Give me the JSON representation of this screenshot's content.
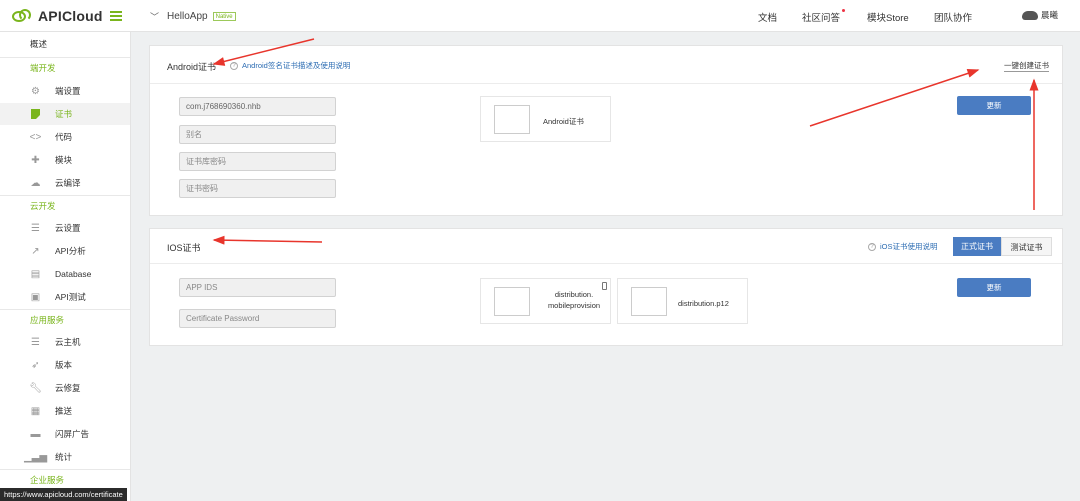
{
  "topbar": {
    "logo_text": "APICloud",
    "app_name": "HelloApp",
    "app_badge": "Native",
    "nav": [
      "文档",
      "社区问答",
      "模块Store",
      "团队协作"
    ],
    "user": "晨曦"
  },
  "sidebar": {
    "overview": "概述",
    "sections": {
      "dev": "端开发",
      "cloud": "云开发",
      "app_services": "应用服务",
      "enterprise": "企业服务"
    },
    "dev_items": [
      "端设置",
      "证书",
      "代码",
      "模块",
      "云编译"
    ],
    "cloud_items": [
      "云设置",
      "API分析",
      "Database",
      "API测试"
    ],
    "service_items": [
      "云主机",
      "版本",
      "云修复",
      "推送",
      "闪屏广告",
      "统计"
    ]
  },
  "android": {
    "title": "Android证书",
    "help": "Android签名证书描述及使用说明",
    "one_click": "一键创建证书",
    "package_value": "com.j768690360.nhb",
    "alias_placeholder": "别名",
    "store_pwd_placeholder": "证书库密码",
    "key_pwd_placeholder": "证书密码",
    "cert_label": "Android证书",
    "update_button": "更新"
  },
  "ios": {
    "title": "IOS证书",
    "help": "iOS证书使用说明",
    "tab_prod": "正式证书",
    "tab_test": "测试证书",
    "appid_placeholder": "APP IDS",
    "password_placeholder": "Certificate Password",
    "provision_line1": "distribution.",
    "provision_line2": "mobileprovision",
    "p12_label": "distribution.p12",
    "update_button": "更新"
  },
  "statusbar": "https://www.apicloud.com/certificate",
  "colors": {
    "accent_green": "#7ab51d",
    "button_blue": "#4a7cc2",
    "arrow_red": "#e8352c"
  }
}
